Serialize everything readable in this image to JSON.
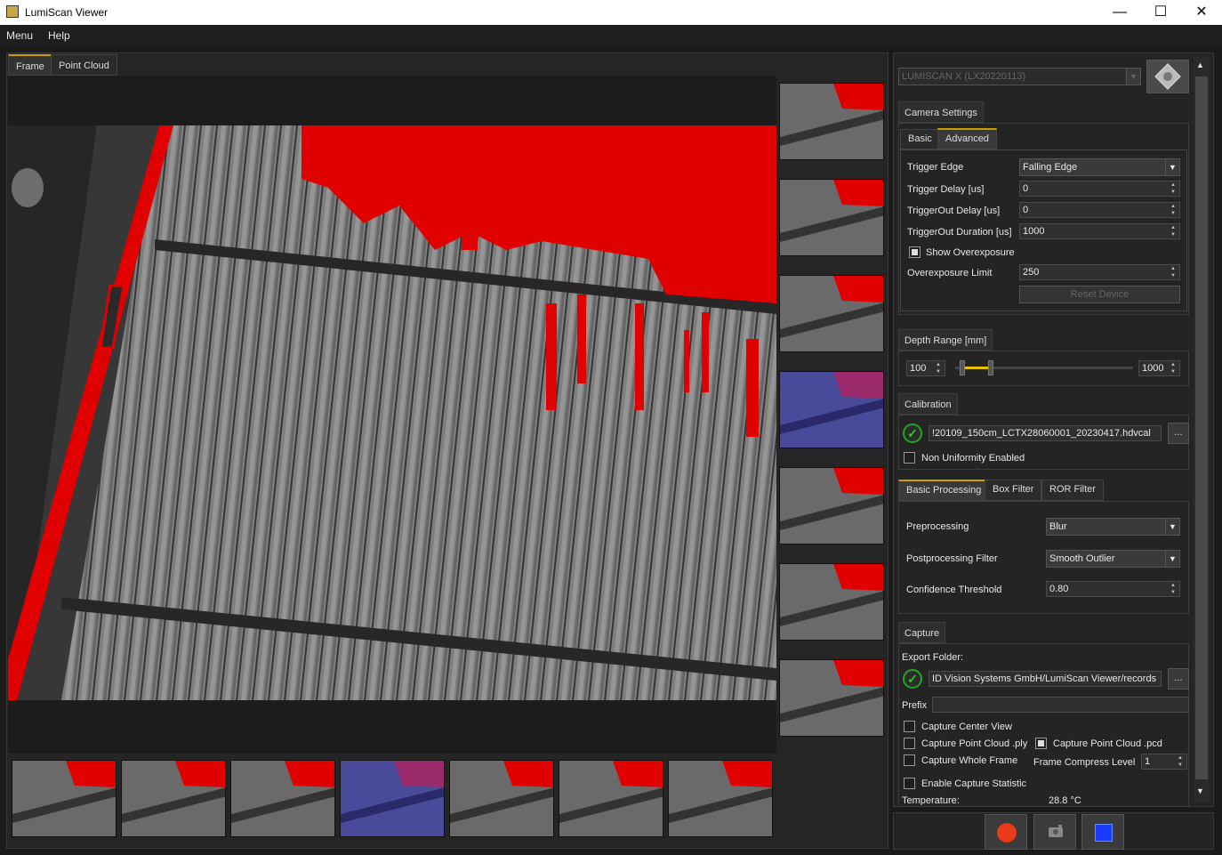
{
  "window": {
    "title": "LumiScan Viewer",
    "minimize": "—",
    "maximize": "☐",
    "close": "✕"
  },
  "menu": {
    "items": [
      "Menu",
      "Help"
    ]
  },
  "viewer": {
    "tabs": [
      "Frame",
      "Point Cloud"
    ],
    "active_tab": "Frame"
  },
  "thumbnails": {
    "right_count": 7,
    "bottom_count": 7,
    "highlighted_index": 3
  },
  "camera": {
    "selected": "LUMISCAN X (LX20220113)"
  },
  "camera_settings": {
    "title": "Camera Settings",
    "tabs": [
      "Basic",
      "Advanced"
    ],
    "active_tab": "Advanced",
    "trigger_edge": {
      "label": "Trigger Edge",
      "value": "Falling Edge"
    },
    "trigger_delay": {
      "label": "Trigger Delay [us]",
      "value": "0"
    },
    "triggerout_delay": {
      "label": "TriggerOut Delay [us]",
      "value": "0"
    },
    "triggerout_duration": {
      "label": "TriggerOut Duration [us]",
      "value": "1000"
    },
    "show_overexposure": {
      "label": "Show Overexposure",
      "checked": true
    },
    "overexposure_limit": {
      "label": "Overexposure Limit",
      "value": "250"
    },
    "reset_device": "Reset Device"
  },
  "depth_range": {
    "title": "Depth Range [mm]",
    "min": "100",
    "max": "1000",
    "low": 0.04,
    "high": 0.2
  },
  "calibration": {
    "title": "Calibration",
    "file": "!20109_150cm_LCTX28060001_20230417.hdvcal",
    "browse": "...",
    "non_uniformity": {
      "label": "Non Uniformity Enabled",
      "checked": false
    }
  },
  "processing": {
    "tabs": [
      "Basic Processing",
      "Box Filter",
      "ROR Filter"
    ],
    "active_tab": "Basic Processing",
    "preprocessing": {
      "label": "Preprocessing",
      "value": "Blur"
    },
    "postprocessing": {
      "label": "Postprocessing Filter",
      "value": "Smooth Outlier"
    },
    "confidence": {
      "label": "Confidence Threshold",
      "value": "0.80"
    }
  },
  "capture": {
    "title": "Capture",
    "export_folder_label": "Export Folder:",
    "export_folder": "ID Vision Systems GmbH/LumiScan Viewer/records",
    "browse": "...",
    "prefix_label": "Prefix",
    "prefix_value": "",
    "center_view": {
      "label": "Capture Center View",
      "checked": false
    },
    "point_cloud_ply": {
      "label": "Capture Point Cloud .ply",
      "checked": false
    },
    "point_cloud_pcd": {
      "label": "Capture Point Cloud .pcd",
      "checked": true
    },
    "whole_frame": {
      "label": "Capture Whole Frame",
      "checked": false
    },
    "frame_compress_label": "Frame Compress Level",
    "frame_compress_value": "1",
    "capture_statistic": {
      "label": "Enable Capture Statistic",
      "checked": false
    },
    "temperature_label": "Temperature:",
    "temperature_value": "28.8 °C"
  },
  "colors": {
    "overexposure": "#e00000",
    "accent": "#c8a000",
    "ok": "#1fd11f",
    "record": "#e83a1a",
    "stop": "#1a3cff"
  }
}
